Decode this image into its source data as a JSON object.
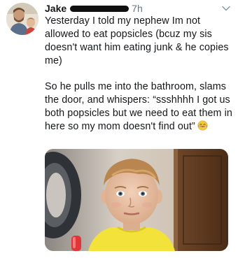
{
  "tweet": {
    "author": {
      "name": "Jake",
      "avatar_icon": "profile-photo-man-with-child"
    },
    "timestamp": "7h",
    "paragraphs": [
      "Yesterday I told my nephew Im not allowed to eat popsicles (bcuz my sis doesn't want him eating junk & he copies me)",
      "So he pulls me into the bathroom, slams the door, and whispers: “ssshhhh I got us both popsicles but we need to eat them in here so my mom doesn't find out”"
    ],
    "emoji": "face-with-tears-of-joy-icon",
    "menu_icon": "chevron-down-icon",
    "media": {
      "kind": "photo",
      "subject": "photo-of-boy-in-bathroom-holding-popsicle"
    }
  },
  "colors": {
    "text": "#14171a",
    "secondary_text": "#657786",
    "background": "#ffffff"
  }
}
